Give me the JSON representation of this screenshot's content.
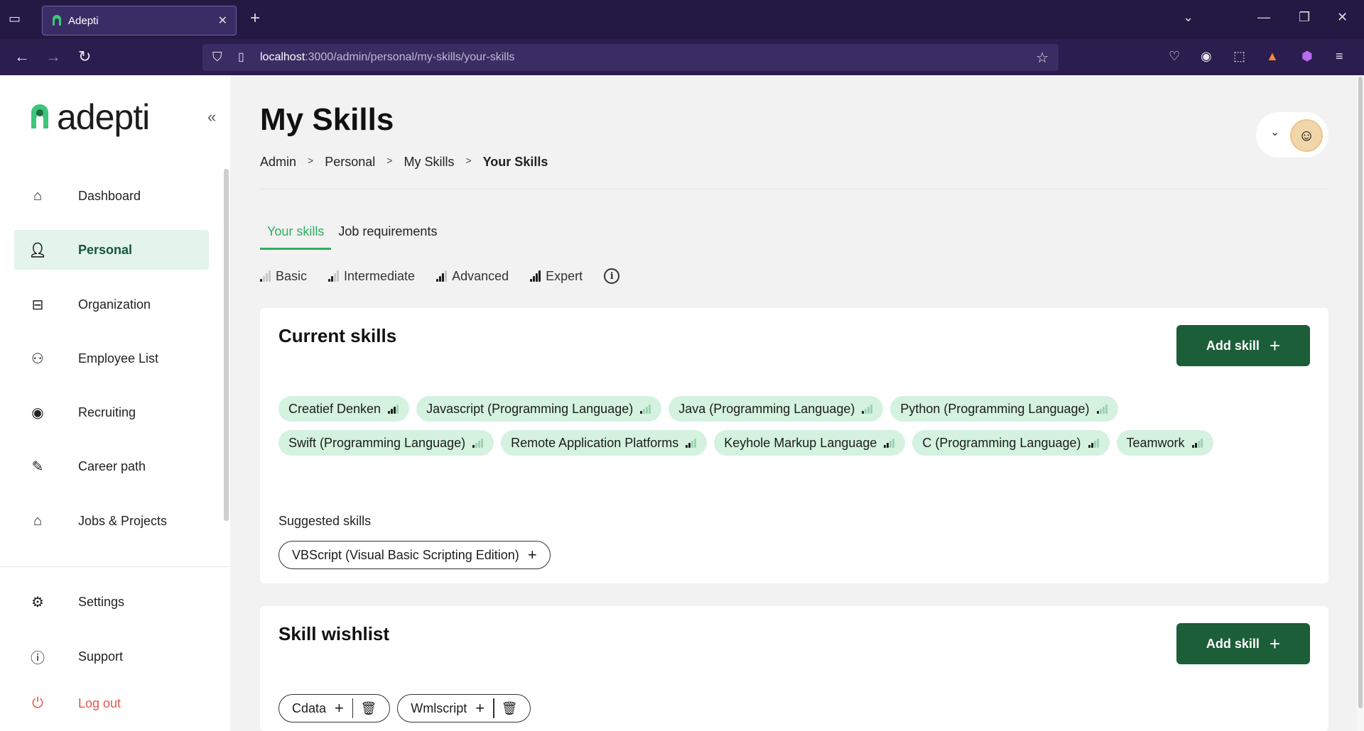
{
  "browser": {
    "tab_title": "Adepti",
    "url_host": "localhost",
    "url_path": ":3000/admin/personal/my-skills/your-skills"
  },
  "sidebar": {
    "logo_text": "adepti",
    "items": [
      {
        "label": "Dashboard",
        "icon": "home-icon"
      },
      {
        "label": "Personal",
        "icon": "user-icon"
      },
      {
        "label": "Organization",
        "icon": "briefcase-icon"
      },
      {
        "label": "Employee List",
        "icon": "users-icon"
      },
      {
        "label": "Recruiting",
        "icon": "eye-icon"
      },
      {
        "label": "Career path",
        "icon": "pen-icon"
      },
      {
        "label": "Jobs & Projects",
        "icon": "jobs-icon"
      }
    ],
    "bottom": [
      {
        "label": "Settings",
        "icon": "gear-icon"
      },
      {
        "label": "Support",
        "icon": "info-icon"
      },
      {
        "label": "Log out",
        "icon": "power-icon"
      }
    ]
  },
  "header": {
    "title": "My Skills",
    "breadcrumb": [
      "Admin",
      "Personal",
      "My Skills",
      "Your Skills"
    ]
  },
  "tabs": [
    "Your skills",
    "Job requirements"
  ],
  "levels": [
    "Basic",
    "Intermediate",
    "Advanced",
    "Expert"
  ],
  "current_skills": {
    "title": "Current skills",
    "add_label": "Add skill",
    "skills": [
      {
        "name": "Creatief Denken",
        "level": 3
      },
      {
        "name": "Javascript (Programming Language)",
        "level": 1
      },
      {
        "name": "Java (Programming Language)",
        "level": 1
      },
      {
        "name": "Python (Programming Language)",
        "level": 1
      },
      {
        "name": "Swift (Programming Language)",
        "level": 1
      },
      {
        "name": "Remote Application Platforms",
        "level": 2
      },
      {
        "name": "Keyhole Markup Language",
        "level": 2
      },
      {
        "name": "C (Programming Language)",
        "level": 2
      },
      {
        "name": "Teamwork",
        "level": 2
      }
    ],
    "suggested_label": "Suggested skills",
    "suggested": [
      "VBScript (Visual Basic Scripting Edition)"
    ]
  },
  "wishlist": {
    "title": "Skill wishlist",
    "add_label": "Add skill",
    "skills": [
      "Cdata",
      "Wmlscript"
    ]
  },
  "colors": {
    "accent": "#2eaf62",
    "button": "#1b5e38",
    "chip": "#d4f2df"
  }
}
